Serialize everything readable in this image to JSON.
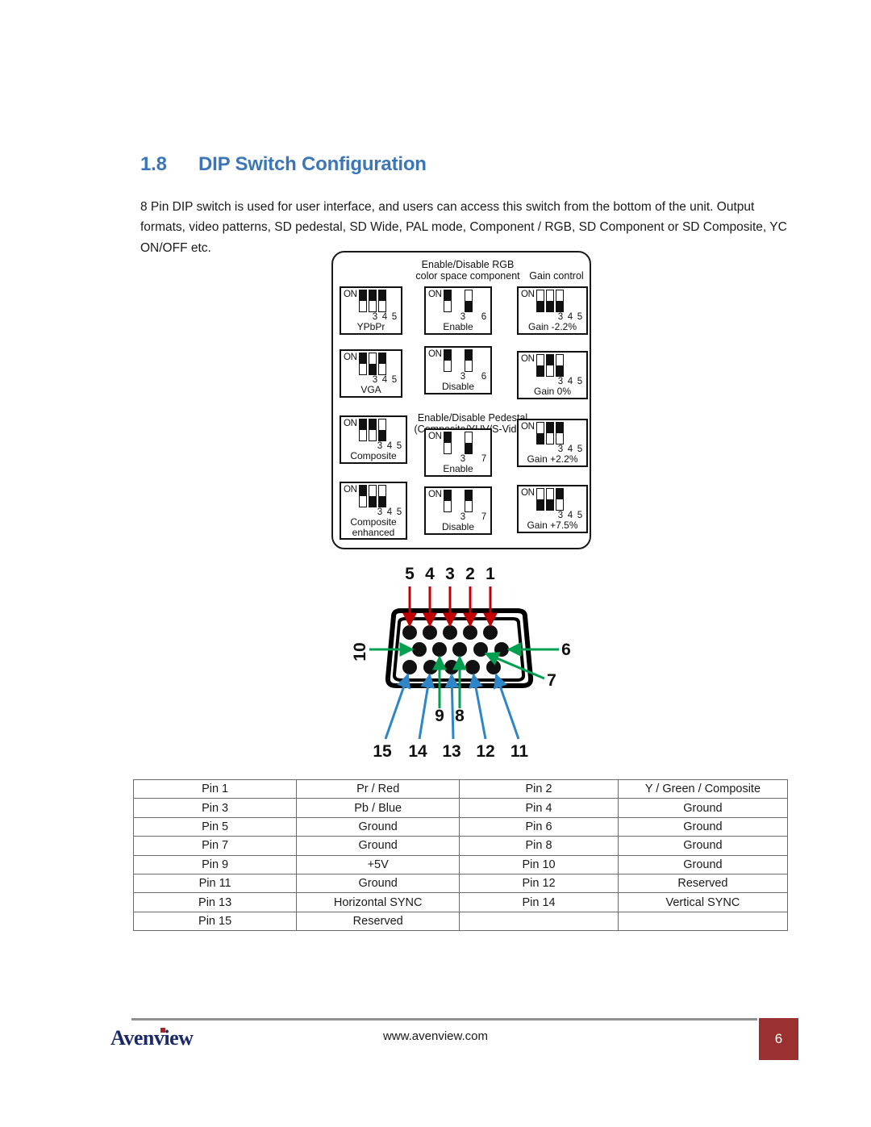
{
  "document": {
    "section_number": "1.8",
    "section_title": "DIP Switch Configuration",
    "intro_paragraph": "8 Pin DIP switch is used for user interface, and users can access this switch from the bottom of the unit. Output formats, video patterns, SD pedestal, SD Wide, PAL mode, Component / RGB, SD Component or SD Composite, YC ON/OFF etc.",
    "heading_color": "#3B76B8"
  },
  "dip_diagram": {
    "captions": {
      "rgb": "Enable/Disable RGB\ncolor space component",
      "rgb_line1": "Enable/Disable RGB",
      "rgb_line2": "color space component",
      "gain": "Gain control",
      "pedestal_line1": "Enable/Disable Pedestal",
      "pedestal_line2": "(Composite/YUV/S-Video)"
    },
    "on_label": "ON",
    "blocks": [
      {
        "id": "ypbpr",
        "label": "YPbPr",
        "label2": "",
        "numbers": [
          "3",
          "4",
          "5"
        ],
        "states": [
          "up",
          "up",
          "up"
        ]
      },
      {
        "id": "vga",
        "label": "VGA",
        "label2": "",
        "numbers": [
          "3",
          "4",
          "5"
        ],
        "states": [
          "up",
          "down",
          "up"
        ]
      },
      {
        "id": "composite",
        "label": "Composite",
        "label2": "",
        "numbers": [
          "3",
          "4",
          "5"
        ],
        "states": [
          "up",
          "up",
          "down"
        ]
      },
      {
        "id": "composite-enhanced",
        "label": "Composite",
        "label2": "enhanced",
        "numbers": [
          "3",
          "4",
          "5"
        ],
        "states": [
          "up",
          "down",
          "down"
        ]
      },
      {
        "id": "rgb-enable",
        "label": "Enable",
        "label2": "",
        "numbers": [
          "3",
          "6"
        ],
        "states": [
          "up",
          "down"
        ]
      },
      {
        "id": "rgb-disable",
        "label": "Disable",
        "label2": "",
        "numbers": [
          "3",
          "6"
        ],
        "states": [
          "up",
          "up"
        ]
      },
      {
        "id": "pedestal-enable",
        "label": "Enable",
        "label2": "",
        "numbers": [
          "3",
          "7"
        ],
        "states": [
          "up",
          "down"
        ]
      },
      {
        "id": "pedestal-disable",
        "label": "Disable",
        "label2": "",
        "numbers": [
          "3",
          "7"
        ],
        "states": [
          "up",
          "up"
        ]
      },
      {
        "id": "gain-minus-2-2",
        "label": "Gain -2.2%",
        "label2": "",
        "numbers": [
          "3",
          "4",
          "5"
        ],
        "states": [
          "down",
          "down",
          "down"
        ]
      },
      {
        "id": "gain-0",
        "label": "Gain 0%",
        "label2": "",
        "numbers": [
          "3",
          "4",
          "5"
        ],
        "states": [
          "down",
          "up",
          "down"
        ]
      },
      {
        "id": "gain-plus-2-2",
        "label": "Gain +2.2%",
        "label2": "",
        "numbers": [
          "3",
          "4",
          "5"
        ],
        "states": [
          "down",
          "up",
          "up"
        ]
      },
      {
        "id": "gain-plus-7-5",
        "label": "Gain +7.5%",
        "label2": "",
        "numbers": [
          "3",
          "4",
          "5"
        ],
        "states": [
          "down",
          "down",
          "up"
        ]
      }
    ]
  },
  "vga_connector": {
    "top_row_labels": [
      "5",
      "4",
      "3",
      "2",
      "1"
    ],
    "middle_row_left_label": "10",
    "middle_row_right_label": "6",
    "middle_row_labels": [
      "9",
      "8"
    ],
    "pin7_label": "7",
    "bottom_row_labels": [
      "15",
      "14",
      "13",
      "12",
      "11"
    ],
    "colors": {
      "top_arrows": "#C00000",
      "middle_arrows": "#00A050",
      "bottom_arrows": "#2E86C8",
      "shell": "#000000"
    }
  },
  "pin_table": {
    "rows": [
      [
        "Pin 1",
        "Pr / Red",
        "Pin 2",
        "Y / Green / Composite"
      ],
      [
        "Pin 3",
        "Pb / Blue",
        "Pin 4",
        "Ground"
      ],
      [
        "Pin 5",
        "Ground",
        "Pin 6",
        "Ground"
      ],
      [
        "Pin 7",
        "Ground",
        "Pin 8",
        "Ground"
      ],
      [
        "Pin 9",
        "+5V",
        "Pin 10",
        "Ground"
      ],
      [
        "Pin 11",
        "Ground",
        "Pin 12",
        "Reserved"
      ],
      [
        "Pin 13",
        "Horizontal SYNC",
        "Pin 14",
        "Vertical SYNC"
      ],
      [
        "Pin 15",
        "Reserved",
        "",
        ""
      ]
    ]
  },
  "footer": {
    "logo_text": "Avenview",
    "url": "www.avenview.com",
    "page_number": "6",
    "badge_color": "#9B3030",
    "logo_color": "#1B2A6B"
  }
}
